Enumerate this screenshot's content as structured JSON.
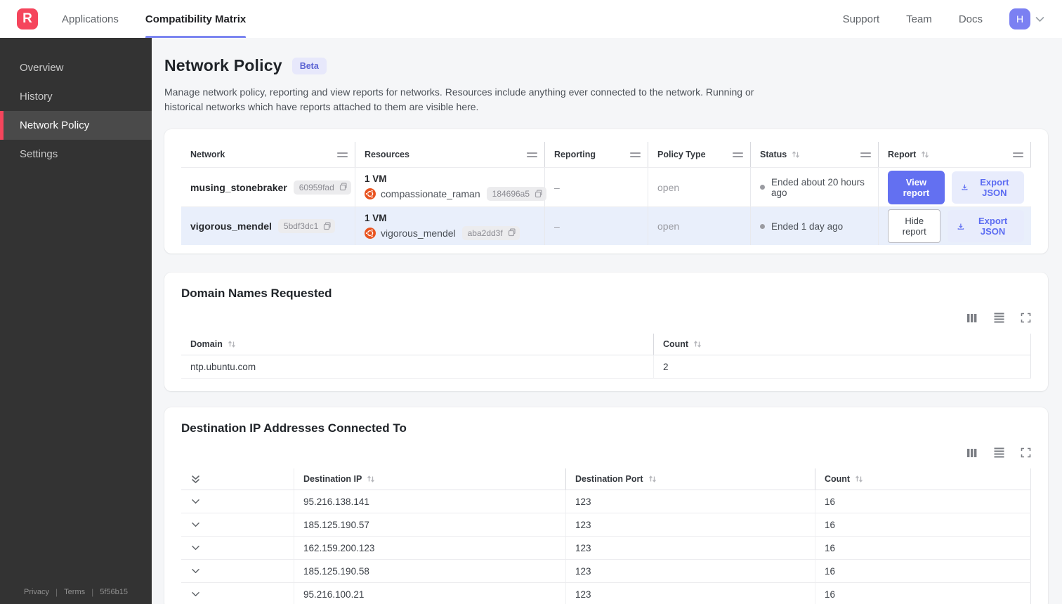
{
  "nav": {
    "logo": "R",
    "tabs": [
      {
        "label": "Applications"
      },
      {
        "label": "Compatibility Matrix"
      }
    ],
    "links": [
      {
        "label": "Support"
      },
      {
        "label": "Team"
      },
      {
        "label": "Docs"
      }
    ],
    "avatar": "H"
  },
  "sidebar": {
    "items": [
      {
        "label": "Overview"
      },
      {
        "label": "History"
      },
      {
        "label": "Network Policy"
      },
      {
        "label": "Settings"
      }
    ],
    "footer": {
      "privacy": "Privacy",
      "terms": "Terms",
      "build": "5f56b15"
    }
  },
  "page": {
    "title": "Network Policy",
    "badge": "Beta",
    "description": "Manage network policy, reporting and view reports for networks. Resources include anything ever connected to the network. Running or historical networks which have reports attached to them are visible here."
  },
  "network_table": {
    "columns": {
      "network": "Network",
      "resources": "Resources",
      "reporting": "Reporting",
      "policy_type": "Policy Type",
      "status": "Status",
      "report": "Report"
    },
    "rows": [
      {
        "name": "musing_stonebraker",
        "id": "60959fad",
        "vm_count": "1 VM",
        "resource_name": "compassionate_raman",
        "resource_id": "184696a5",
        "reporting": "–",
        "policy_type": "open",
        "status": "Ended about 20 hours ago",
        "report_button": "View report",
        "export_button": "Export JSON"
      },
      {
        "name": "vigorous_mendel",
        "id": "5bdf3dc1",
        "vm_count": "1 VM",
        "resource_name": "vigorous_mendel",
        "resource_id": "aba2dd3f",
        "reporting": "–",
        "policy_type": "open",
        "status": "Ended 1 day ago",
        "report_button": "Hide report",
        "export_button": "Export JSON"
      }
    ]
  },
  "domain_card": {
    "title": "Domain Names Requested",
    "columns": {
      "domain": "Domain",
      "count": "Count"
    },
    "rows": [
      {
        "domain": "ntp.ubuntu.com",
        "count": "2"
      }
    ]
  },
  "destination_card": {
    "title": "Destination IP Addresses Connected To",
    "columns": {
      "ip": "Destination IP",
      "port": "Destination Port",
      "count": "Count"
    },
    "rows": [
      {
        "ip": "95.216.138.141",
        "port": "123",
        "count": "16"
      },
      {
        "ip": "185.125.190.57",
        "port": "123",
        "count": "16"
      },
      {
        "ip": "162.159.200.123",
        "port": "123",
        "count": "16"
      },
      {
        "ip": "185.125.190.58",
        "port": "123",
        "count": "16"
      },
      {
        "ip": "95.216.100.21",
        "port": "123",
        "count": "16"
      }
    ]
  },
  "colors": {
    "brand_red": "#f5455c",
    "accent_indigo": "#6370f1",
    "accent_light": "#e8ecfc",
    "row_highlight": "#e9effb",
    "ubuntu_orange": "#e95420",
    "sidebar_bg": "#333333"
  }
}
